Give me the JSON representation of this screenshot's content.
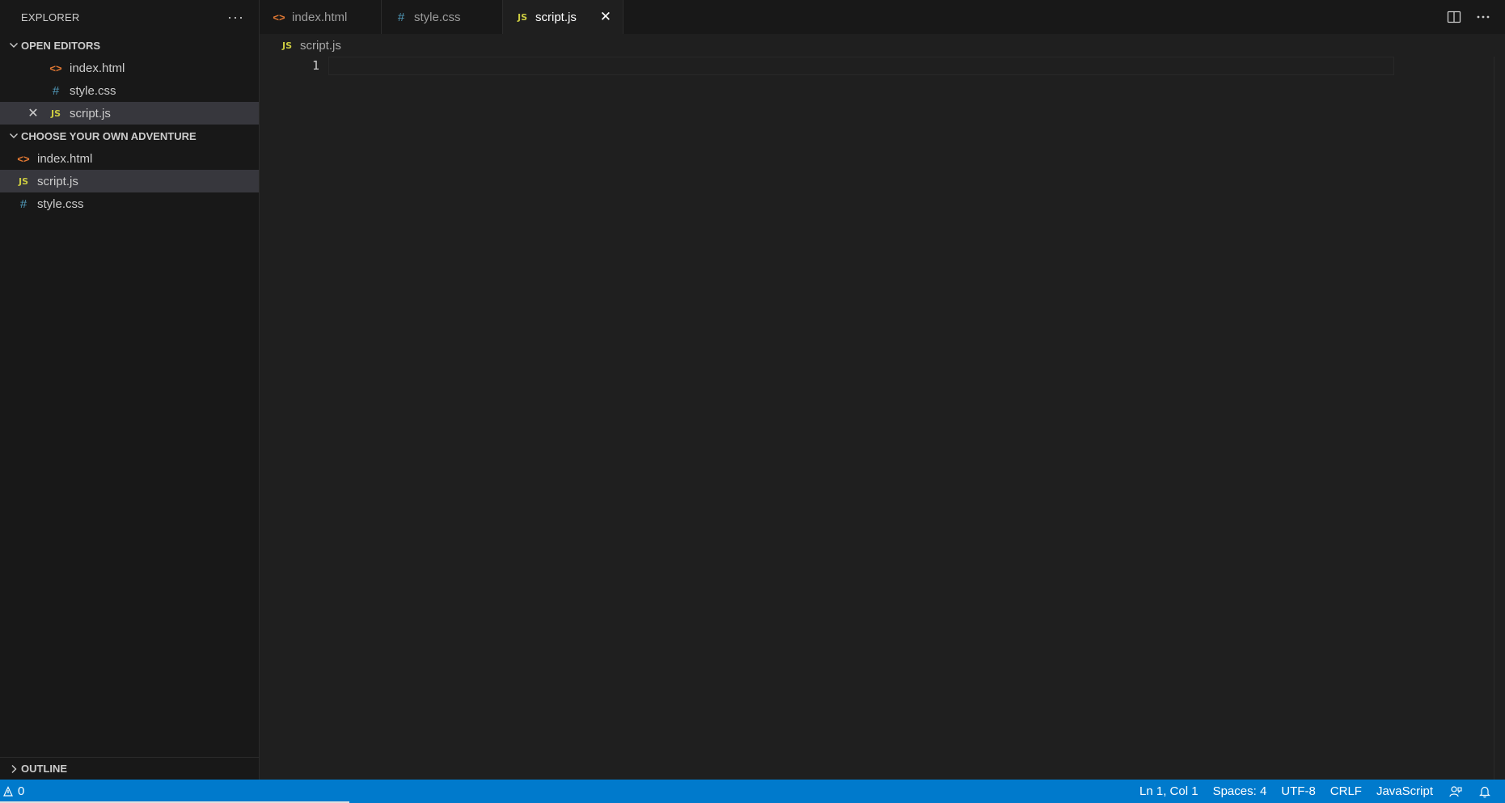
{
  "sidebar": {
    "title": "EXPLORER",
    "more_label": "···",
    "open_editors": {
      "header": "OPEN EDITORS",
      "items": [
        {
          "label": "index.html",
          "icon": "html-file-icon"
        },
        {
          "label": "style.css",
          "icon": "css-file-icon"
        },
        {
          "label": "script.js",
          "icon": "js-file-icon"
        }
      ]
    },
    "folder": {
      "header": "CHOOSE YOUR OWN ADVENTURE",
      "items": [
        {
          "label": "index.html",
          "icon": "html-file-icon"
        },
        {
          "label": "script.js",
          "icon": "js-file-icon"
        },
        {
          "label": "style.css",
          "icon": "css-file-icon"
        }
      ]
    },
    "outline_header": "OUTLINE"
  },
  "icons": {
    "html_glyph": "<>",
    "css_glyph": "#",
    "js_glyph": "JS",
    "close_glyph": "✕"
  },
  "tabs": [
    {
      "label": "index.html",
      "icon": "html-file-icon",
      "active": false
    },
    {
      "label": "style.css",
      "icon": "css-file-icon",
      "active": false
    },
    {
      "label": "script.js",
      "icon": "js-file-icon",
      "active": true
    }
  ],
  "breadcrumb": {
    "file": "script.js"
  },
  "editor": {
    "line_numbers": [
      "1"
    ],
    "content": ""
  },
  "statusbar": {
    "problems_count": "0",
    "position": "Ln 1, Col 1",
    "spaces": "Spaces: 4",
    "encoding": "UTF-8",
    "eol": "CRLF",
    "language": "JavaScript"
  },
  "colors": {
    "accent_statusbar": "#007acc",
    "html_icon": "#e37933",
    "css_icon": "#519aba",
    "js_icon": "#cbcb41",
    "editor_bg": "#1f1f1f",
    "sidebar_bg": "#181818"
  }
}
